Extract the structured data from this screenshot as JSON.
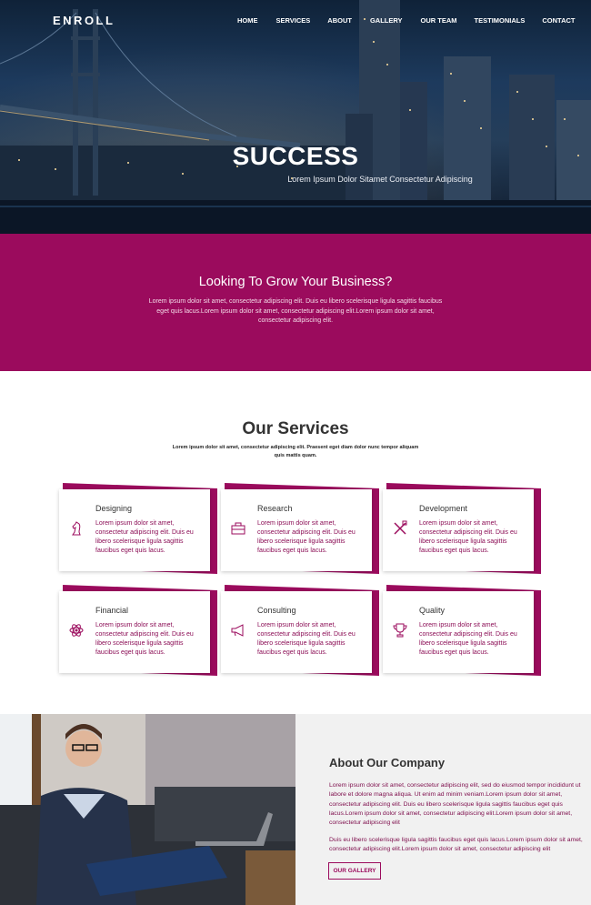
{
  "brand": "ENROLL",
  "nav": [
    "HOME",
    "SERVICES",
    "ABOUT",
    "GALLERY",
    "OUR TEAM",
    "TESTIMONIALS",
    "CONTACT"
  ],
  "hero": {
    "title": "SUCCESS",
    "subtitle": "Lorem Ipsum Dolor Sitamet Consectetur Adipiscing"
  },
  "grow": {
    "title": "Looking To Grow Your Business?",
    "text": "Lorem ipsum dolor sit amet, consectetur adipiscing elit. Duis eu libero scelerisque ligula sagittis faucibus eget quis lacus.Lorem ipsum dolor sit amet, consectetur adipiscing elit.Lorem ipsum dolor sit amet, consectetur adipiscing elit."
  },
  "services": {
    "title": "Our Services",
    "subtitle": "Lorem ipsum dolor sit amet, consectetur adipiscing elit. Praesent eget diam dolor nunc tempor aliquam quis mattis quam.",
    "items": [
      {
        "title": "Designing",
        "icon": "chess-knight-icon",
        "text": "Lorem ipsum dolor sit amet, consectetur adipiscing elit. Duis eu libero scelerisque ligula sagittis faucibus eget quis lacus."
      },
      {
        "title": "Research",
        "icon": "briefcase-icon",
        "text": "Lorem ipsum dolor sit amet, consectetur adipiscing elit. Duis eu libero scelerisque ligula sagittis faucibus eget quis lacus."
      },
      {
        "title": "Development",
        "icon": "tools-icon",
        "text": "Lorem ipsum dolor sit amet, consectetur adipiscing elit. Duis eu libero scelerisque ligula sagittis faucibus eget quis lacus."
      },
      {
        "title": "Financial",
        "icon": "atom-icon",
        "text": "Lorem ipsum dolor sit amet, consectetur adipiscing elit. Duis eu libero scelerisque ligula sagittis faucibus eget quis lacus."
      },
      {
        "title": "Consulting",
        "icon": "megaphone-icon",
        "text": "Lorem ipsum dolor sit amet, consectetur adipiscing elit. Duis eu libero scelerisque ligula sagittis faucibus eget quis lacus."
      },
      {
        "title": "Quality",
        "icon": "trophy-icon",
        "text": "Lorem ipsum dolor sit amet, consectetur adipiscing elit. Duis eu libero scelerisque ligula sagittis faucibus eget quis lacus."
      }
    ]
  },
  "about": {
    "title": "About Our Company",
    "p1": "Lorem ipsum dolor sit amet, consectetur adipiscing elit, sed do eiusmod tempor incididunt ut labore et dolore magna aliqua. Ut enim ad minim veniam.Lorem ipsum dolor sit amet, consectetur adipiscing elit. Duis eu libero scelerisque ligula sagittis faucibus eget quis lacus.Lorem ipsum dolor sit amet, consectetur adipiscing elit.Lorem ipsum dolor sit amet, consectetur adipiscing elit",
    "p2": "Duis eu libero scelerisque ligula sagittis faucibus eget quis lacus.Lorem ipsum dolor sit amet, consectetur adipiscing elit.Lorem ipsum dolor sit amet, consectetur adipiscing elit",
    "button": "OUR GALLERY"
  },
  "colors": {
    "accent": "#9b0b5d",
    "hero_dark": "#0f2238"
  }
}
